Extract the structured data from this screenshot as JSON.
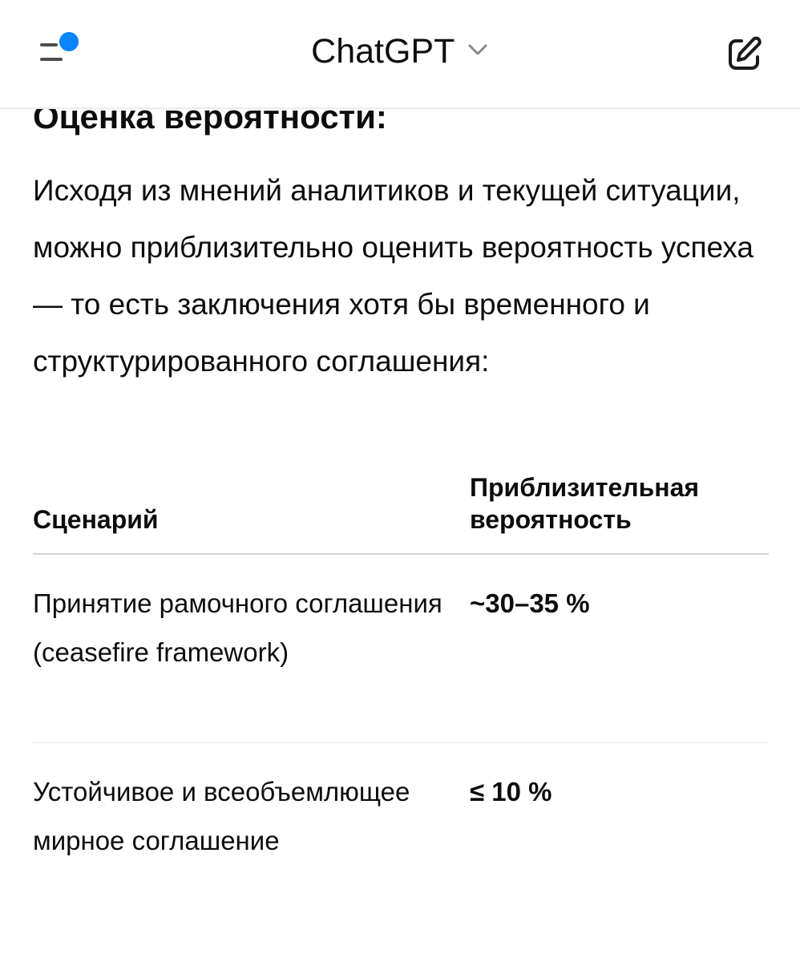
{
  "header": {
    "title": "ChatGPT",
    "menu_icon": "sidebar-menu-icon",
    "notification_color": "#0a84ff",
    "title_chevron_icon": "chevron-down-icon",
    "new_chat_icon": "edit-square-icon"
  },
  "message": {
    "heading": "Оценка вероятности:",
    "intro": "Исходя из мнений аналитиков и текущей ситуации, можно приблизительно оценить вероятность успеха — то есть заключения хотя бы временного и структурированного соглашения:",
    "table": {
      "headers": [
        "Сценарий",
        "Приблизительная вероятность"
      ],
      "rows": [
        {
          "scenario": "Принятие рамочного соглашения (ceasefire framework)",
          "probability": "~30–35 %"
        },
        {
          "scenario": "Устойчивое и всеобъемлющее мирное соглашение",
          "probability": "≤ 10 %"
        }
      ]
    }
  }
}
